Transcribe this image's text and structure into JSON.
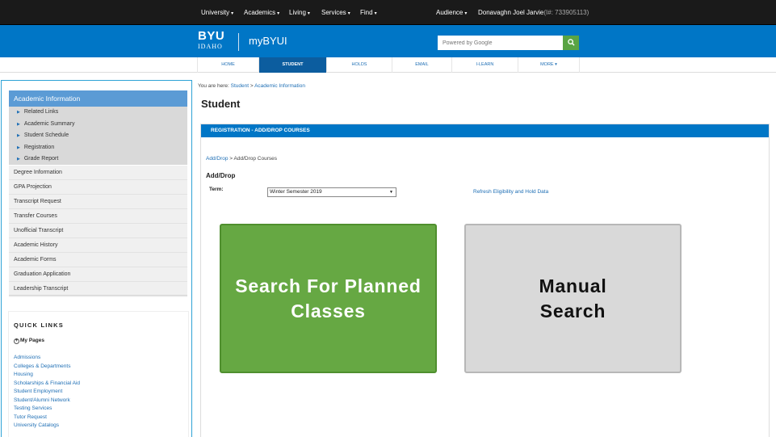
{
  "topnav": {
    "items": [
      "University",
      "Academics",
      "Living",
      "Services",
      "Find"
    ],
    "audience": "Audience",
    "user_name": "Donavaghn Joel Jarvie",
    "user_id": "(I#: 733905113)"
  },
  "header": {
    "logo_main": "BYU",
    "logo_sub": "IDAHO",
    "app_name": "myBYUI",
    "search_placeholder": "Powered by Google"
  },
  "tabs": [
    {
      "label": "HOME",
      "active": false
    },
    {
      "label": "STUDENT",
      "active": true
    },
    {
      "label": "HOLDS",
      "active": false
    },
    {
      "label": "EMAIL",
      "active": false
    },
    {
      "label": "I-LEARN",
      "active": false
    },
    {
      "label": "MORE",
      "active": false
    }
  ],
  "sidebar": {
    "section_title": "Academic Information",
    "sub_items": [
      "Related Links",
      "Academic Summary",
      "Student Schedule",
      "Registration",
      "Grade Report"
    ],
    "items": [
      "Degree Information",
      "GPA Projection",
      "Transcript Request",
      "Transfer Courses",
      "Unofficial Transcript",
      "Academic History",
      "Academic Forms",
      "Graduation Application",
      "Leadership Transcript"
    ]
  },
  "quick_links": {
    "title": "QUICK LINKS",
    "my_pages": "My Pages",
    "links": [
      "Admissions",
      "Colleges & Departments",
      "Housing",
      "Scholarships & Financial Aid",
      "Student Employment",
      "Student/Alumni Network",
      "Testing Services",
      "Tutor Request",
      "University Catalogs"
    ]
  },
  "breadcrumb": {
    "prefix": "You are here:",
    "path1": "Student",
    "sep": ">",
    "path2": "Academic Information"
  },
  "page_title": "Student",
  "panel": {
    "header": "REGISTRATION - ADD/DROP COURSES",
    "sub_crumb_link": "Add/Drop",
    "sub_crumb_sep": ">",
    "sub_crumb_current": "Add/Drop Courses",
    "section_title": "Add/Drop",
    "term_label": "Term:",
    "term_value": "Winter Semester 2019",
    "refresh_link": "Refresh Eligibility and Hold Data",
    "planned_button": "Search For Planned Classes",
    "manual_button": "Manual Search"
  },
  "colors": {
    "brand_blue": "#0076c6",
    "tab_active": "#0c5d9f",
    "planned_green": "#66a843",
    "manual_gray": "#d9d9d9",
    "link_blue": "#1f6fb5"
  }
}
